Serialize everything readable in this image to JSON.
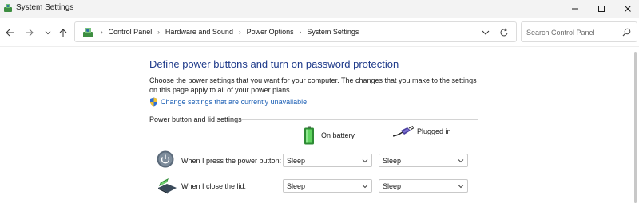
{
  "window": {
    "title": "System Settings",
    "controls": {
      "minimize_icon": "minimize-icon",
      "maximize_icon": "maximize-icon",
      "close_icon": "close-icon"
    }
  },
  "navigation": {
    "back_icon": "arrow-left-icon",
    "forward_icon": "arrow-right-icon",
    "recent_icon": "chevron-down-icon",
    "up_icon": "arrow-up-icon"
  },
  "address_bar": {
    "breadcrumb": [
      "Control Panel",
      "Hardware and Sound",
      "Power Options",
      "System Settings"
    ],
    "separator": "›",
    "refresh_icon": "refresh-icon"
  },
  "search": {
    "placeholder": "Search Control Panel",
    "value": "",
    "icon": "search-icon"
  },
  "main": {
    "title": "Define power buttons and turn on password protection",
    "description": "Choose the power settings that you want for your computer. The changes that you make to the settings on this page apply to all of your power plans.",
    "change_settings_link": "Change settings that are currently unavailable",
    "section_label": "Power button and lid settings",
    "columns": [
      {
        "label": "On battery",
        "icon": "battery-icon"
      },
      {
        "label": "Plugged in",
        "icon": "power-plug-icon"
      }
    ],
    "rows": [
      {
        "label": "When I press the power button:",
        "icon": "power-button-icon",
        "on_battery": "Sleep",
        "plugged_in": "Sleep"
      },
      {
        "label": "When I close the lid:",
        "icon": "laptop-lid-icon",
        "on_battery": "Sleep",
        "plugged_in": "Sleep"
      }
    ]
  },
  "colors": {
    "title": "#1e3a8a",
    "link": "#1b5fb5",
    "titlebar_bg": "#f3f3f3",
    "battery_green": "#3cb043"
  }
}
